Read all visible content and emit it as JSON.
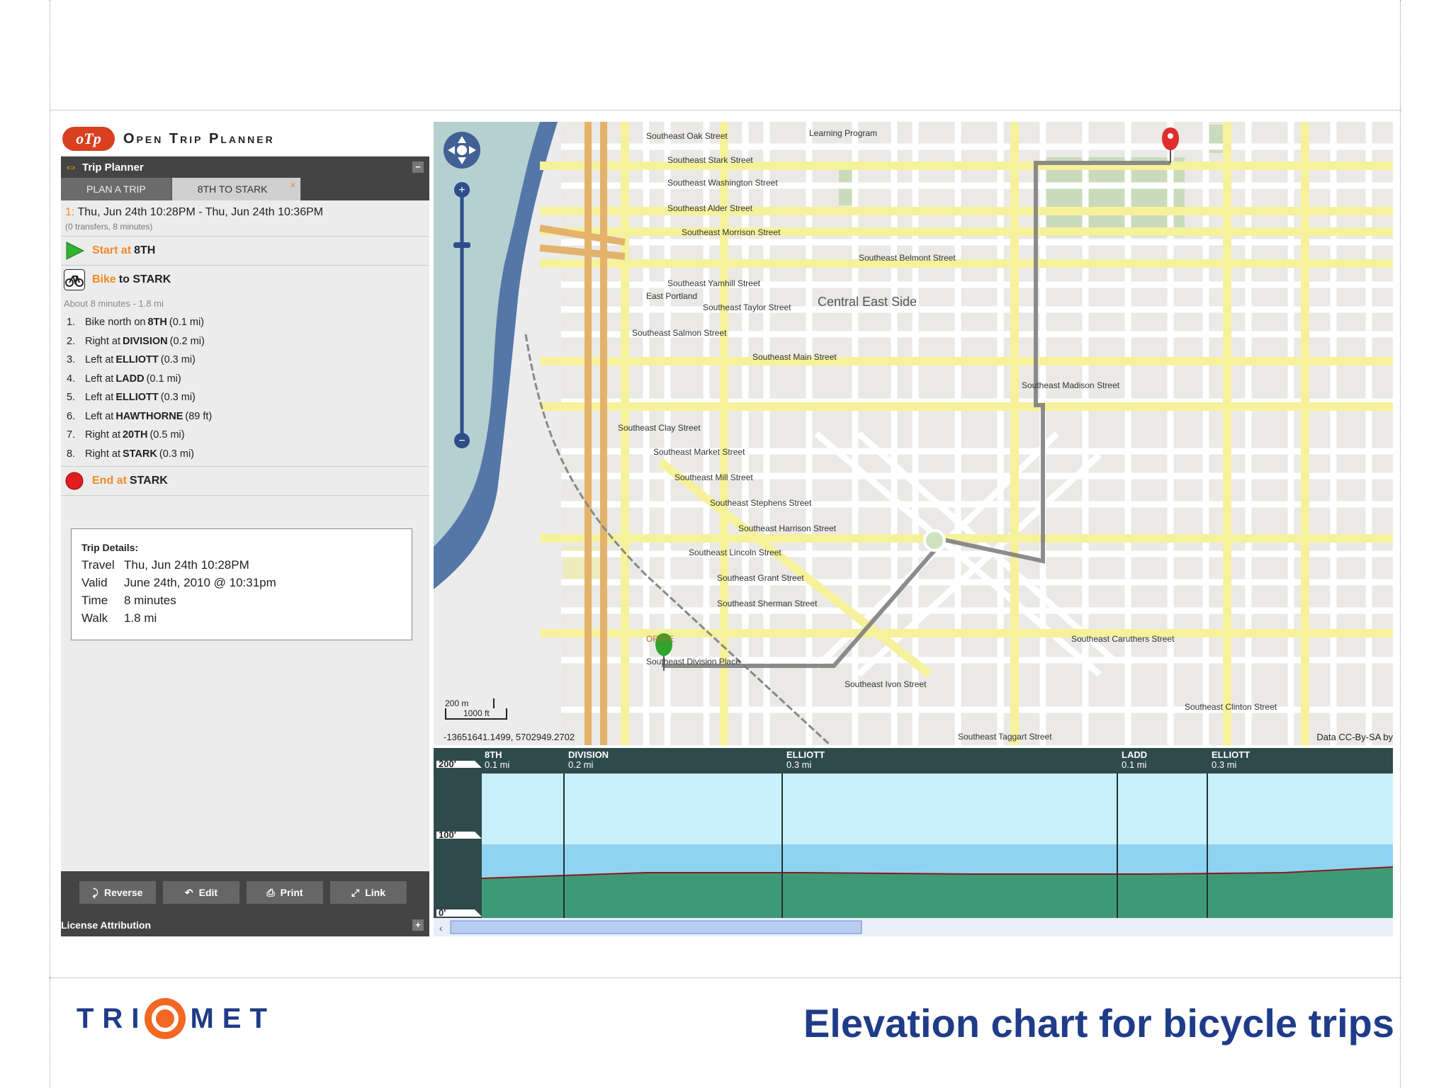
{
  "app": {
    "logo_text": "oTp",
    "title": "Open Trip Planner",
    "panel_title": "Trip Planner",
    "collapse_label": "−",
    "expand_label": "+"
  },
  "tabs": [
    {
      "label": "PLAN A TRIP"
    },
    {
      "label": "8TH TO STARK",
      "close": "×"
    }
  ],
  "itinerary": {
    "number": "1:",
    "times": "Thu, Jun 24th 10:28PM - Thu, Jun 24th 10:36PM",
    "summary": "(0 transfers, 8 minutes)"
  },
  "legs": {
    "start_prefix": "Start at",
    "start_place": "8TH",
    "bike_prefix": "Bike",
    "bike_to": "to STARK",
    "about": "About 8 minutes - 1.8 mi",
    "end_prefix": "End at",
    "end_place": "STARK"
  },
  "steps": [
    {
      "num": "1.",
      "pre": "Bike north on",
      "street": "8TH",
      "dist": "(0.1 mi)"
    },
    {
      "num": "2.",
      "pre": "Right at",
      "street": "DIVISION",
      "dist": "(0.2 mi)"
    },
    {
      "num": "3.",
      "pre": "Left at",
      "street": "ELLIOTT",
      "dist": "(0.3 mi)"
    },
    {
      "num": "4.",
      "pre": "Left at",
      "street": "LADD",
      "dist": "(0.1 mi)"
    },
    {
      "num": "5.",
      "pre": "Left at",
      "street": "ELLIOTT",
      "dist": "(0.3 mi)"
    },
    {
      "num": "6.",
      "pre": "Left at",
      "street": "HAWTHORNE",
      "dist": "(89 ft)"
    },
    {
      "num": "7.",
      "pre": "Right at",
      "street": "20TH",
      "dist": "(0.5 mi)"
    },
    {
      "num": "8.",
      "pre": "Right at",
      "street": "STARK",
      "dist": "(0.3 mi)"
    }
  ],
  "trip_details": {
    "title": "Trip Details:",
    "rows": [
      {
        "k": "Travel",
        "v": "Thu, Jun 24th 10:28PM"
      },
      {
        "k": "Valid",
        "v": "June 24th, 2010 @ 10:31pm"
      },
      {
        "k": "Time",
        "v": "8 minutes"
      },
      {
        "k": "Walk",
        "v": "1.8 mi"
      }
    ]
  },
  "buttons": {
    "reverse": "Reverse",
    "edit": "Edit",
    "print": "Print",
    "link": "Link"
  },
  "license": "License Attribution",
  "map": {
    "area_label": "Central East Side",
    "coords": "-13651641.1499, 5702949.2702",
    "attribution": "Data CC-By-SA by",
    "scale_m": "200 m",
    "scale_ft": "1000 ft",
    "street_labels": [
      "Southeast Oak Street",
      "Southeast Stark Street",
      "Southeast Washington Street",
      "Southeast Alder Street",
      "Southeast Morrison Street",
      "Southeast Belmont Street",
      "Southeast Yamhill Street",
      "East Portland",
      "Southeast Taylor Street",
      "Southeast Salmon Street",
      "Southeast Main Street",
      "Southeast Madison Street",
      "Southeast Clay Street",
      "Southeast Market Street",
      "Southeast Mill Street",
      "Southeast Stephens Street",
      "Southeast Harrison Street",
      "Southeast Lincoln Street",
      "Southeast Grant Street",
      "Southeast Sherman Street",
      "Southeast Division Place",
      "Southeast Ivon Street",
      "Southeast Clinton Street",
      "Southeast Caruthers Street",
      "Southeast Taggart Street",
      "OR99E",
      "Learning Program"
    ]
  },
  "elevation": {
    "y_labels": [
      "200'",
      "100'",
      "0'"
    ],
    "segments": [
      {
        "name": "8TH",
        "dist": "0.1 mi"
      },
      {
        "name": "DIVISION",
        "dist": "0.2 mi"
      },
      {
        "name": "ELLIOTT",
        "dist": "0.3 mi"
      },
      {
        "name": "LADD",
        "dist": "0.1 mi"
      },
      {
        "name": "ELLIOTT",
        "dist": "0.3 mi"
      }
    ]
  },
  "footer": {
    "logo_left": "TRI",
    "logo_right": "MET",
    "slide_title": "Elevation chart for bicycle trips"
  },
  "colors": {
    "accent_orange": "#f08a24",
    "panel_dark": "#444444",
    "route": "#7f7f7f",
    "title_blue": "#1f3c88"
  }
}
